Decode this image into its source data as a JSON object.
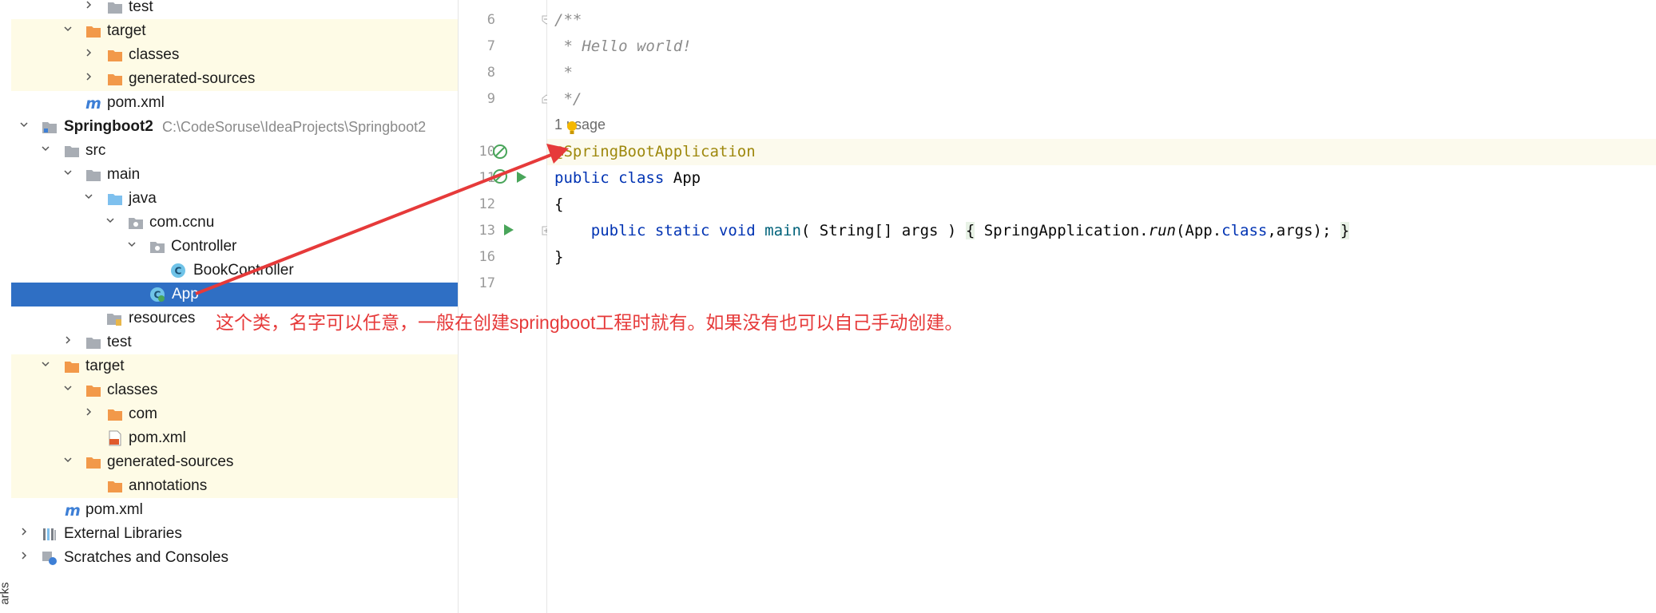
{
  "side_strip": {
    "label": "arks"
  },
  "project_tree": {
    "items": [
      {
        "label": "test"
      },
      {
        "label": "target"
      },
      {
        "label": "classes"
      },
      {
        "label": "generated-sources"
      },
      {
        "label": "pom.xml"
      },
      {
        "label": "Springboot2",
        "path": "C:\\CodeSoruse\\IdeaProjects\\Springboot2"
      },
      {
        "label": "src"
      },
      {
        "label": "main"
      },
      {
        "label": "java"
      },
      {
        "label": "com.ccnu"
      },
      {
        "label": "Controller"
      },
      {
        "label": "BookController"
      },
      {
        "label": "App"
      },
      {
        "label": "resources"
      },
      {
        "label": "test"
      },
      {
        "label": "target"
      },
      {
        "label": "classes"
      },
      {
        "label": "com"
      },
      {
        "label": "pom.xml"
      },
      {
        "label": "generated-sources"
      },
      {
        "label": "annotations"
      },
      {
        "label": "pom.xml"
      },
      {
        "label": "External Libraries"
      },
      {
        "label": "Scratches and Consoles"
      }
    ]
  },
  "editor": {
    "line_numbers": [
      "6",
      "7",
      "8",
      "9",
      "10",
      "11",
      "12",
      "13",
      "16",
      "17"
    ],
    "usage_hint": "1 usage",
    "lines": {
      "l6": "/**",
      "l7": " * Hello world!",
      "l8": " *",
      "l9": " */",
      "l10_annotation": "@SpringBootApplication",
      "l11_kw1": "public",
      "l11_kw2": "class",
      "l11_name": "App",
      "l12": "{",
      "l13_mods": "public static void",
      "l13_fn": "main",
      "l13_params": "( String[] args )",
      "l13_open": "{",
      "l13_call_a": "SpringApplication.",
      "l13_call_run": "run",
      "l13_call_b": "(App.",
      "l13_call_class": "class",
      "l13_call_c": ",args);",
      "l13_close": "}",
      "l16": "}"
    }
  },
  "annotation_text": "这个类，名字可以任意，一般在创建springboot工程时就有。如果没有也可以自己手动创建。",
  "colors": {
    "selection": "#2f6fc4",
    "excluded_bg": "#fefbe6",
    "folder_orange": "#f2994a",
    "folder_gray": "#a8adb4",
    "folder_blue": "#7ec0ee",
    "maven_blue": "#3d7fd6",
    "annotation_red": "#e63a3a",
    "keyword": "#0033b3",
    "comment": "#8c8c8c",
    "annotation_code": "#9e880d",
    "run_green": "#49a55a"
  }
}
